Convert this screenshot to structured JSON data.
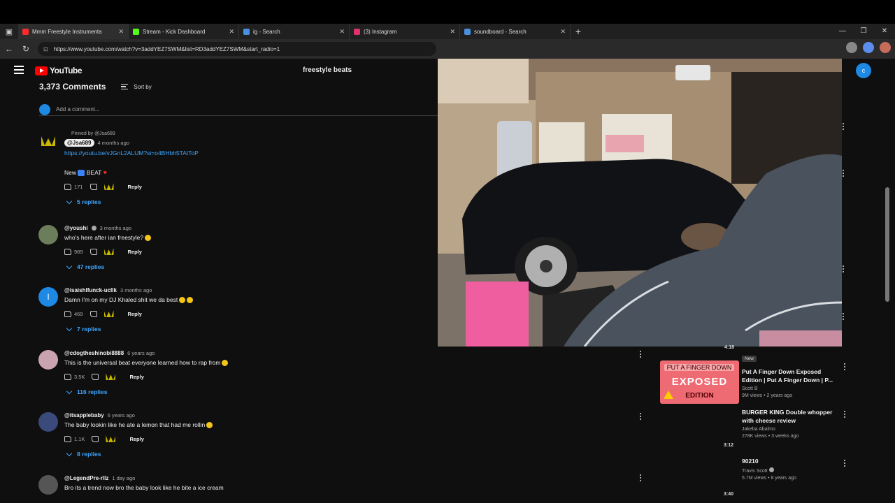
{
  "tabs": [
    {
      "title": "Mmm Freestyle Instrumenta",
      "fav": "#ff2a2a",
      "active": true
    },
    {
      "title": "Stream - Kick Dashboard",
      "fav": "#53fc18",
      "active": false
    },
    {
      "title": "ig - Search",
      "fav": "#4a90e2",
      "active": false
    },
    {
      "title": "(3) Instagram",
      "fav": "#e1306c",
      "active": false
    },
    {
      "title": "soundboard - Search",
      "fav": "#4a90e2",
      "active": false
    }
  ],
  "address": {
    "url": "https://www.youtube.com/watch?v=3addYEZ7SWM&list=RD3addYEZ7SWM&start_radio=1"
  },
  "youtube": {
    "logo_text": "YouTube",
    "search_value": "freestyle beats",
    "avatar_letter": "c",
    "comments_count": "3,373 Comments",
    "sort_label": "Sort by",
    "add_comment_placeholder": "Add a comment..."
  },
  "comments": [
    {
      "pinned": "Pinned by @Jsa689",
      "handle": "@Jsa689",
      "time": "4 months ago",
      "link": "https://youtu.be/vJGnL2ALUM?si=o4BHbh5TAIToP",
      "text": "New",
      "text2": "BEAT",
      "likes": "171",
      "replies": "5 replies",
      "avatar_color": "#000"
    },
    {
      "handle": "@youshi",
      "time": "3 months ago",
      "text": "who's here after ian freestyle?",
      "likes": "989",
      "replies": "47 replies",
      "avatar_color": "#6b7d5a"
    },
    {
      "handle": "@isaishlfunck-ucllk",
      "time": "3 months ago",
      "text": "Damn I'm on my DJ Khaled shit we da best",
      "likes": "469",
      "replies": "7 replies",
      "avatar_color": "#1e88e5",
      "avatar_letter": "I"
    },
    {
      "handle": "@cdogtheshinobi8888",
      "time": "6 years ago",
      "text": "This is the universal beat everyone learned how to rap from",
      "likes": "3.5K",
      "replies": "116 replies",
      "avatar_color": "#caa3b0"
    },
    {
      "handle": "@itsapplebaby",
      "time": "6 years ago",
      "text": "The baby lookin like he ate a lemon that had me rollin",
      "likes": "1.1K",
      "replies": "8 replies",
      "avatar_color": "#3a4a7a"
    },
    {
      "handle": "@LegendPre-rllz",
      "time": "1 day ago",
      "text": "Bro its a trend now bro the baby look like he bite a ice cream",
      "avatar_color": "#555"
    }
  ],
  "reply_label": "Reply",
  "recommendations": [
    {
      "duration": "4:18",
      "badge": "New",
      "title": "Put A Finger Down Exposed Edition | Put A Finger Down | P...",
      "channel": "Scott B",
      "stats": "9M views • 2 years ago",
      "thumb_l1": "PUT A FINGER DOWN",
      "thumb_l2": "EXPOSED",
      "thumb_l3": "EDITION"
    },
    {
      "duration": "3:12",
      "title": "BURGER KING Double whopper with cheese review",
      "channel": "Jakeba Abalmo",
      "stats": "278K views • 3 weeks ago"
    },
    {
      "duration": "3:40",
      "title": "90210",
      "channel": "Travis Scott",
      "stats": "5.7M views • 8 years ago"
    }
  ]
}
